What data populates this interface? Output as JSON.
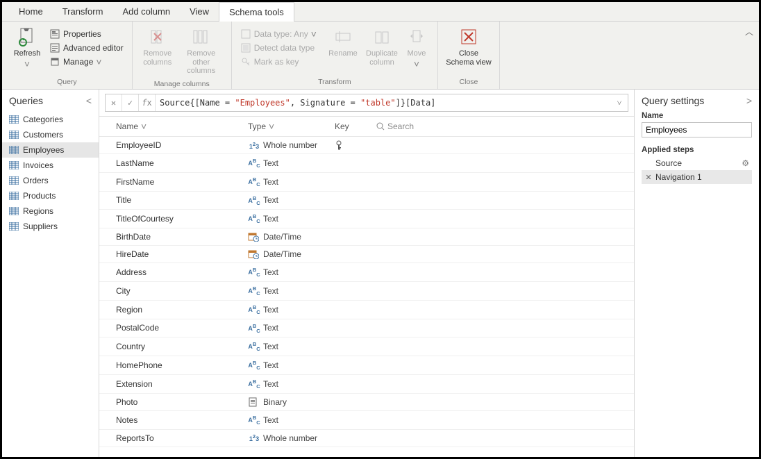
{
  "tabs": {
    "home": "Home",
    "transform": "Transform",
    "addcolumn": "Add column",
    "view": "View",
    "schematools": "Schema tools"
  },
  "ribbon": {
    "query": {
      "refresh": "Refresh",
      "properties": "Properties",
      "advanced": "Advanced editor",
      "manage": "Manage",
      "group": "Query"
    },
    "managecols": {
      "removecols": "Remove columns",
      "removeother": "Remove other columns",
      "group": "Manage columns"
    },
    "transform": {
      "datatype": "Data type: Any",
      "detect": "Detect data type",
      "markkey": "Mark as key",
      "rename": "Rename",
      "dupcol": "Duplicate column",
      "move": "Move",
      "group": "Transform"
    },
    "close": {
      "closeschema": "Close Schema view",
      "group": "Close"
    }
  },
  "queries": {
    "title": "Queries",
    "items": [
      "Categories",
      "Customers",
      "Employees",
      "Invoices",
      "Orders",
      "Products",
      "Regions",
      "Suppliers"
    ],
    "selected": "Employees"
  },
  "formula": {
    "pre": "Source{[Name = ",
    "s1": "\"Employees\"",
    "mid": ", Signature = ",
    "s2": "\"table\"",
    "post": "]}[Data]"
  },
  "grid": {
    "headers": {
      "name": "Name",
      "type": "Type",
      "key": "Key",
      "search": "Search"
    },
    "rows": [
      {
        "name": "EmployeeID",
        "typeIcon": "num",
        "type": "Whole number",
        "key": true
      },
      {
        "name": "LastName",
        "typeIcon": "abc",
        "type": "Text",
        "key": false
      },
      {
        "name": "FirstName",
        "typeIcon": "abc",
        "type": "Text",
        "key": false
      },
      {
        "name": "Title",
        "typeIcon": "abc",
        "type": "Text",
        "key": false
      },
      {
        "name": "TitleOfCourtesy",
        "typeIcon": "abc",
        "type": "Text",
        "key": false
      },
      {
        "name": "BirthDate",
        "typeIcon": "dt",
        "type": "Date/Time",
        "key": false
      },
      {
        "name": "HireDate",
        "typeIcon": "dt",
        "type": "Date/Time",
        "key": false
      },
      {
        "name": "Address",
        "typeIcon": "abc",
        "type": "Text",
        "key": false
      },
      {
        "name": "City",
        "typeIcon": "abc",
        "type": "Text",
        "key": false
      },
      {
        "name": "Region",
        "typeIcon": "abc",
        "type": "Text",
        "key": false
      },
      {
        "name": "PostalCode",
        "typeIcon": "abc",
        "type": "Text",
        "key": false
      },
      {
        "name": "Country",
        "typeIcon": "abc",
        "type": "Text",
        "key": false
      },
      {
        "name": "HomePhone",
        "typeIcon": "abc",
        "type": "Text",
        "key": false
      },
      {
        "name": "Extension",
        "typeIcon": "abc",
        "type": "Text",
        "key": false
      },
      {
        "name": "Photo",
        "typeIcon": "bin",
        "type": "Binary",
        "key": false
      },
      {
        "name": "Notes",
        "typeIcon": "abc",
        "type": "Text",
        "key": false
      },
      {
        "name": "ReportsTo",
        "typeIcon": "num",
        "type": "Whole number",
        "key": false
      }
    ]
  },
  "settings": {
    "title": "Query settings",
    "nameLabel": "Name",
    "nameValue": "Employees",
    "appliedSteps": "Applied steps",
    "steps": [
      {
        "label": "Source",
        "gear": true,
        "del": false
      },
      {
        "label": "Navigation 1",
        "gear": false,
        "del": true
      }
    ],
    "selectedStep": "Navigation 1"
  }
}
